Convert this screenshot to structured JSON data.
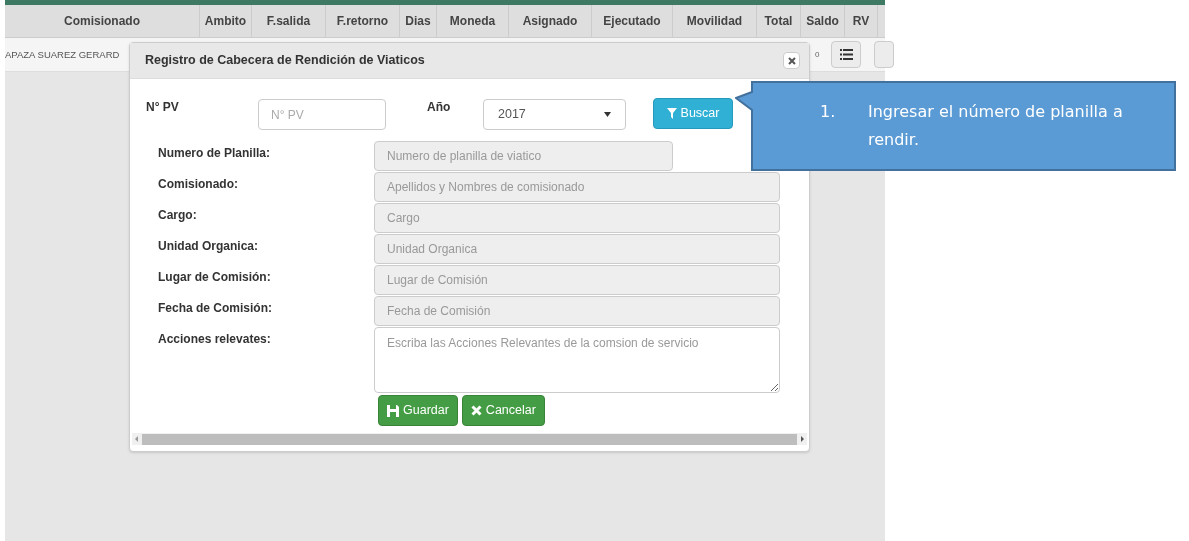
{
  "table": {
    "columns": [
      "Comisionado",
      "Ambito",
      "F.salida",
      "F.retorno",
      "Dias",
      "Moneda",
      "Asignado",
      "Ejecutado",
      "Movilidad",
      "Total",
      "Saldo",
      "RV"
    ],
    "rows": [
      {
        "comisionado": "APAZA SUAREZ GERARD",
        "saldo": "0"
      }
    ]
  },
  "modal": {
    "title": "Registro de Cabecera de Rendición de Viaticos",
    "search": {
      "pv_label": "N° PV",
      "pv_placeholder": "N° PV",
      "year_label": "Año",
      "year_value": "2017",
      "button": "Buscar"
    },
    "fields": [
      {
        "label": "Numero de Planilla:",
        "placeholder": "Numero de planilla de viatico",
        "kind": "short"
      },
      {
        "label": "Comisionado:",
        "placeholder": "Apellidos y Nombres de comisionado",
        "kind": "input"
      },
      {
        "label": "Cargo:",
        "placeholder": "Cargo",
        "kind": "input"
      },
      {
        "label": "Unidad Organica:",
        "placeholder": "Unidad Organica",
        "kind": "input"
      },
      {
        "label": "Lugar de Comisión:",
        "placeholder": "Lugar de Comisión",
        "kind": "input"
      },
      {
        "label": "Fecha de Comisión:",
        "placeholder": "Fecha de Comisión",
        "kind": "input"
      },
      {
        "label": "Acciones relevates:",
        "placeholder": "Escriba las Acciones Relevantes de la comsion de servicio",
        "kind": "textarea"
      }
    ],
    "buttons": [
      {
        "label": "Guardar",
        "kind": "save"
      },
      {
        "label": "Cancelar",
        "kind": "cancel"
      }
    ]
  },
  "callout": {
    "number": "1.",
    "text": "Ingresar el número de planilla a rendir."
  }
}
